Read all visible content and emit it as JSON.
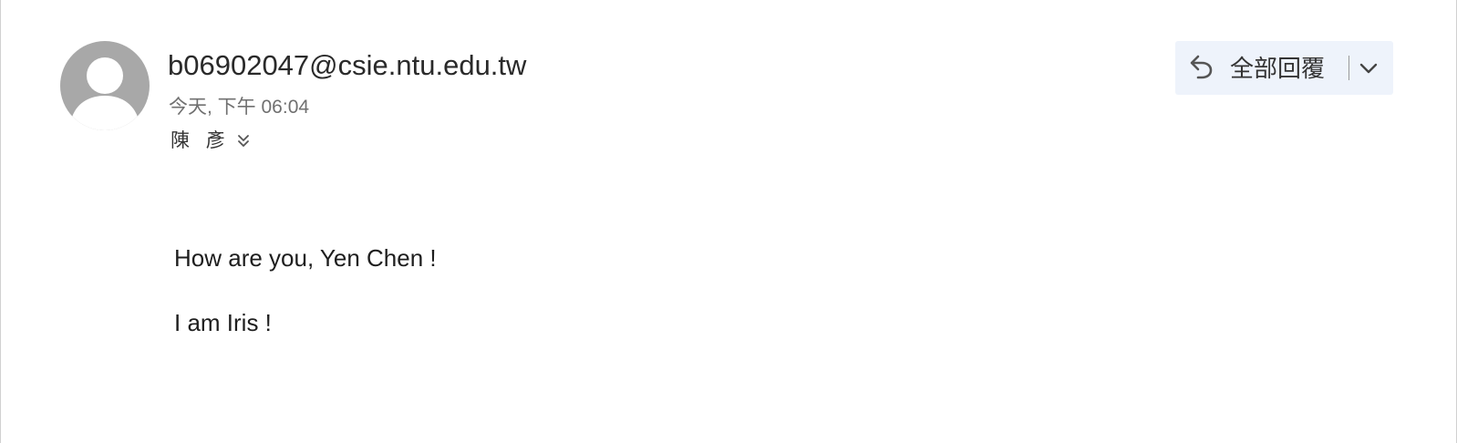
{
  "message": {
    "sender_email": "b06902047@csie.ntu.edu.tw",
    "timestamp": "今天, 下午 06:04",
    "recipient": "陳 彥",
    "body_lines": [
      "How are you, Yen Chen !",
      "I am Iris !"
    ]
  },
  "actions": {
    "reply_all_label": "全部回覆"
  },
  "icons": {
    "avatar": "default-user-avatar",
    "expand": "double-chevron-down-icon",
    "reply": "reply-all-arrow-icon",
    "dropdown": "chevron-down-icon"
  },
  "colors": {
    "avatar_bg": "#a8a8a8",
    "button_bg": "#eef3fb",
    "text_primary": "#2a2a2a",
    "text_secondary": "#707070"
  }
}
